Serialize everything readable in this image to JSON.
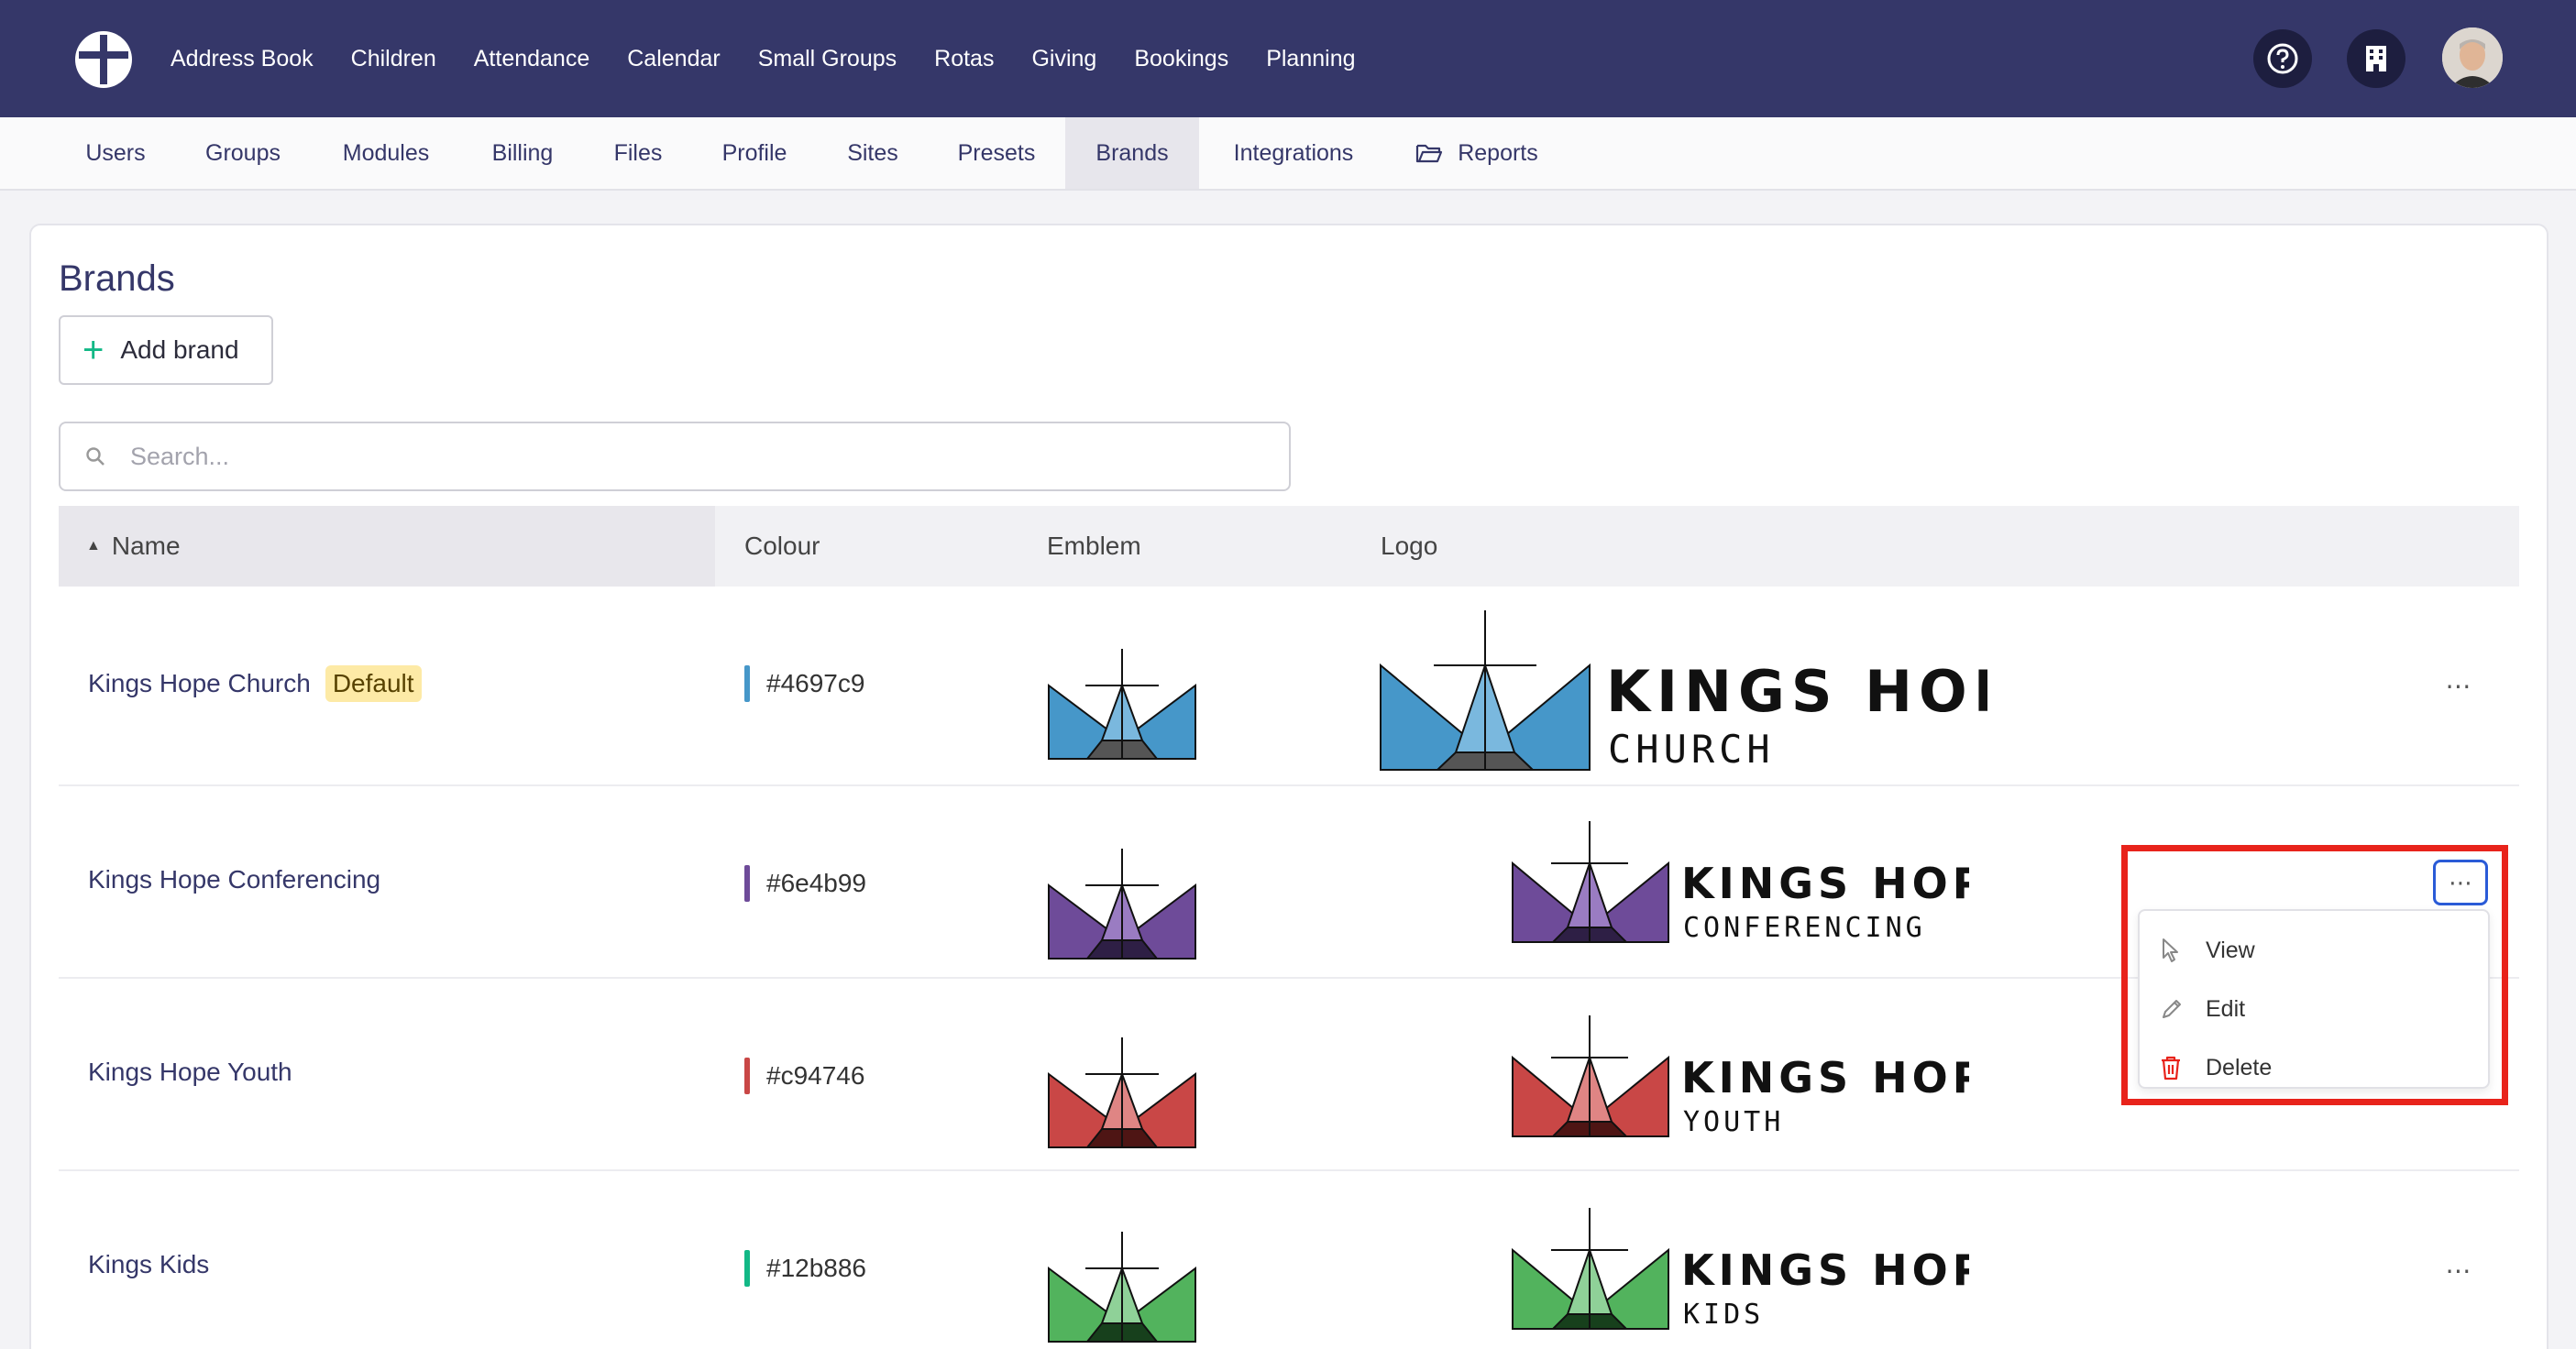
{
  "top_nav": {
    "items": [
      "Address Book",
      "Children",
      "Attendance",
      "Calendar",
      "Small Groups",
      "Rotas",
      "Giving",
      "Bookings",
      "Planning"
    ]
  },
  "sub_nav": {
    "tabs": [
      "Users",
      "Groups",
      "Modules",
      "Billing",
      "Files",
      "Profile",
      "Sites",
      "Presets",
      "Brands",
      "Integrations",
      "Reports"
    ],
    "active": "Brands"
  },
  "page": {
    "title": "Brands",
    "add_button_label": "Add brand",
    "search_placeholder": "Search..."
  },
  "table": {
    "headers": {
      "name": "Name",
      "colour": "Colour",
      "emblem": "Emblem",
      "logo": "Logo"
    },
    "rows": [
      {
        "name": "Kings Hope Church",
        "badge": "Default",
        "colour": "#4697c9",
        "logo_title": "KINGS HOPE",
        "logo_subtitle": "CHURCH"
      },
      {
        "name": "Kings Hope Conferencing",
        "badge": "",
        "colour": "#6e4b99",
        "logo_title": "KINGS HOPE",
        "logo_subtitle": "CONFERENCING"
      },
      {
        "name": "Kings Hope Youth",
        "badge": "",
        "colour": "#c94746",
        "logo_title": "KINGS HOPE",
        "logo_subtitle": "YOUTH"
      },
      {
        "name": "Kings Kids",
        "badge": "",
        "colour": "#12b886",
        "logo_title": "KINGS HOPE",
        "logo_subtitle": "KIDS"
      }
    ]
  },
  "row_menu": {
    "items": [
      "View",
      "Edit",
      "Delete"
    ]
  },
  "icons": {
    "logo": "church-logo-icon",
    "help": "question-circle-icon",
    "org": "building-icon",
    "reports": "folder-open-icon",
    "search": "search-icon",
    "row_actions": "ellipsis-icon"
  },
  "colors": {
    "topbar": "#353769",
    "accent_add": "#12b886",
    "delete": "#e8231b"
  }
}
